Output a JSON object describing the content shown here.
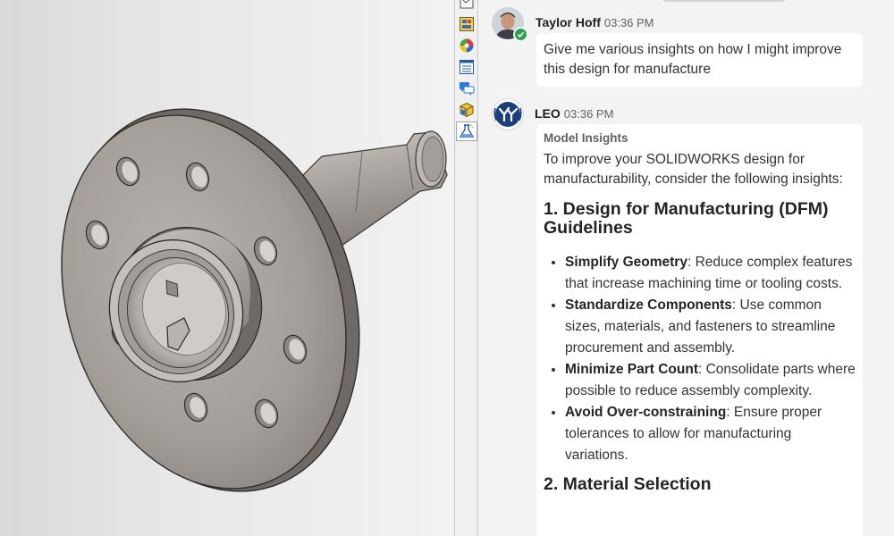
{
  "task_pane": {
    "tabs": [
      {
        "icon": "sw-resources-icon"
      },
      {
        "icon": "design-library-icon"
      },
      {
        "icon": "appearances-icon"
      },
      {
        "icon": "custom-properties-icon"
      },
      {
        "icon": "forum-icon"
      },
      {
        "icon": "3d-content-icon"
      },
      {
        "icon": "leo-assistant-icon",
        "active": true
      }
    ]
  },
  "chat": {
    "messages": [
      {
        "author": "Taylor Hoff",
        "time": "03:36 PM",
        "presence": "available",
        "text": "Give me various insights on how I might improve this design for manufacture"
      },
      {
        "author": "LEO",
        "time": "03:36 PM",
        "label": "Model Insights",
        "intro": "To improve your SOLIDWORKS design for manufacturability, consider the following insights:",
        "sections": [
          {
            "heading": "1. Design for Manufacturing (DFM) Guidelines",
            "items": [
              {
                "title": "Simplify Geometry",
                "body": ": Reduce complex features that increase machining time or tooling costs."
              },
              {
                "title": "Standardize Components",
                "body": ": Use common sizes, materials, and fasteners to streamline procurement and assembly."
              },
              {
                "title": "Minimize Part Count",
                "body": ": Consolidate parts where possible to reduce assembly complexity."
              },
              {
                "title": "Avoid Over-constraining",
                "body": ": Ensure proper tolerances to allow for manufacturing variations."
              }
            ]
          },
          {
            "heading": "2. Material Selection",
            "items": []
          }
        ]
      }
    ]
  },
  "colors": {
    "chat_bg": "#f3f3f3",
    "bubble_bg": "#ffffff",
    "presence_green": "#2e9e4f",
    "leo_brand": "#1b3f7a"
  }
}
